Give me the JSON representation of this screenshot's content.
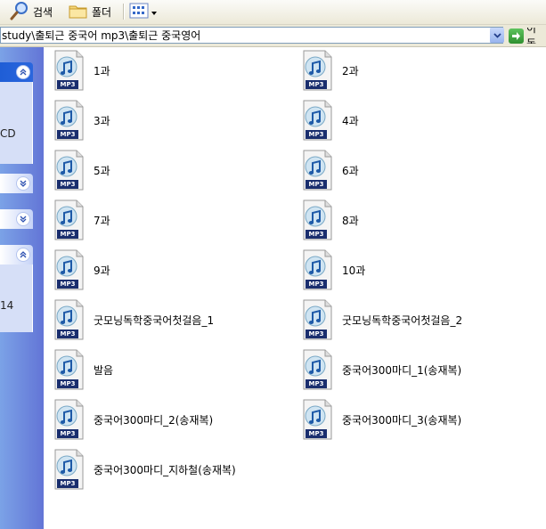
{
  "toolbar": {
    "search_label": "검색",
    "folders_label": "폴더"
  },
  "address": {
    "path": "study\\출퇴근 중국어 mp3\\출퇴근 중국영어",
    "go_label": "이동"
  },
  "taskpane": {
    "fragment1": "CD",
    "fragment2": "14"
  },
  "files": [
    {
      "name": "1과",
      "type": "MP3"
    },
    {
      "name": "2과",
      "type": "MP3"
    },
    {
      "name": "3과",
      "type": "MP3"
    },
    {
      "name": "4과",
      "type": "MP3"
    },
    {
      "name": "5과",
      "type": "MP3"
    },
    {
      "name": "6과",
      "type": "MP3"
    },
    {
      "name": "7과",
      "type": "MP3"
    },
    {
      "name": "8과",
      "type": "MP3"
    },
    {
      "name": "9과",
      "type": "MP3"
    },
    {
      "name": "10과",
      "type": "MP3"
    },
    {
      "name": "굿모닝독학중국어첫걸음_1",
      "type": "MP3"
    },
    {
      "name": "굿모닝독학중국어첫걸음_2",
      "type": "MP3"
    },
    {
      "name": "발음",
      "type": "MP3"
    },
    {
      "name": "중국어300마디_1(송재복)",
      "type": "MP3"
    },
    {
      "name": "중국어300마디_2(송재복)",
      "type": "MP3"
    },
    {
      "name": "중국어300마디_3(송재복)",
      "type": "MP3"
    },
    {
      "name": "중국어300마디_지하철(송재복)",
      "type": "MP3"
    }
  ]
}
